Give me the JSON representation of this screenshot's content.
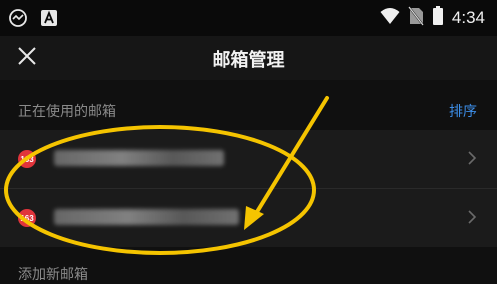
{
  "status_bar": {
    "time": "4:34",
    "left_icons": [
      "app-notification-icon",
      "a-badge-icon"
    ],
    "right_icons": [
      "wifi-icon",
      "no-sim-icon",
      "battery-icon"
    ]
  },
  "header": {
    "title": "邮箱管理",
    "close_icon": "close-icon"
  },
  "section": {
    "label": "正在使用的邮箱",
    "sort_label": "排序"
  },
  "accounts": [
    {
      "logo_text": "163",
      "logo_color": "#e0343b",
      "address_visible": "",
      "masked": true
    },
    {
      "logo_text": "163",
      "logo_color": "#e0343b",
      "address_visible": "",
      "masked": true
    }
  ],
  "add_mailbox_label": "添加新邮箱",
  "annotation": {
    "color": "#f5c400",
    "shapes": [
      "ellipse-highlight",
      "arrow"
    ]
  }
}
